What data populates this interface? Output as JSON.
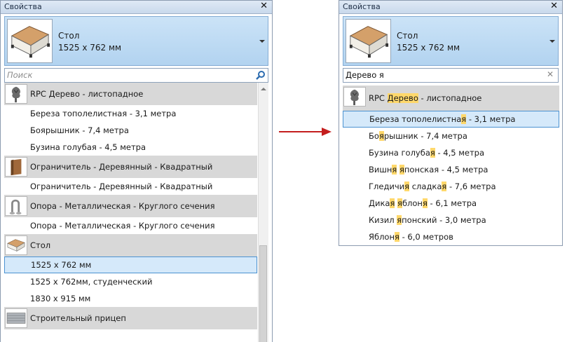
{
  "left": {
    "title": "Свойства",
    "close_label": "✕",
    "type_selector": {
      "name": "Стол",
      "size": "1525 x 762 мм"
    },
    "search": {
      "placeholder": "Поиск",
      "value": ""
    },
    "rows": [
      {
        "kind": "family",
        "icon": "tree-icon",
        "label": "RPC Дерево - листопадное"
      },
      {
        "kind": "type",
        "label": "Береза тополелистная - 3,1 метра"
      },
      {
        "kind": "type",
        "label": "Боярышник - 7,4 метра"
      },
      {
        "kind": "type",
        "label": "Бузина голубая - 4,5 метра"
      },
      {
        "kind": "family",
        "icon": "wood-block-icon",
        "label": "Ограничитель - Деревянный - Квадратный"
      },
      {
        "kind": "type",
        "label": "Ограничитель - Деревянный - Квадратный"
      },
      {
        "kind": "family",
        "icon": "post-icon",
        "label": "Опора - Металлическая - Круглого сечения"
      },
      {
        "kind": "type",
        "label": "Опора - Металлическая - Круглого сечения"
      },
      {
        "kind": "family",
        "icon": "table-icon",
        "label": "Стол"
      },
      {
        "kind": "type",
        "selected": true,
        "label": "1525 x 762 мм"
      },
      {
        "kind": "type",
        "label": "1525 x 762мм, студенческий"
      },
      {
        "kind": "type",
        "label": "1830 x 915 мм"
      },
      {
        "kind": "family",
        "icon": "trailer-icon",
        "label": "Строительный прицеп"
      }
    ]
  },
  "right": {
    "title": "Свойства",
    "close_label": "✕",
    "type_selector": {
      "name": "Стол",
      "size": "1525 x 762 мм"
    },
    "search": {
      "value": "Дерево я",
      "clear_label": "✕"
    },
    "rows": [
      {
        "kind": "family",
        "icon": "tree-icon",
        "parts": [
          {
            "t": "RPC "
          },
          {
            "t": "Дерево",
            "hl": true
          },
          {
            "t": " - листопадное"
          }
        ]
      },
      {
        "kind": "type",
        "selected": true,
        "parts": [
          {
            "t": "Береза тополелистна"
          },
          {
            "t": "я",
            "hl": true
          },
          {
            "t": " - 3,1 метра"
          }
        ]
      },
      {
        "kind": "type",
        "parts": [
          {
            "t": "Бо"
          },
          {
            "t": "я",
            "hl": true
          },
          {
            "t": "рышник - 7,4 метра"
          }
        ]
      },
      {
        "kind": "type",
        "parts": [
          {
            "t": "Бузина голуба"
          },
          {
            "t": "я",
            "hl": true
          },
          {
            "t": " - 4,5 метра"
          }
        ]
      },
      {
        "kind": "type",
        "parts": [
          {
            "t": "Вишн"
          },
          {
            "t": "я",
            "hl": true
          },
          {
            "t": " "
          },
          {
            "t": "я",
            "hl": true
          },
          {
            "t": "понская - 4,5 метра"
          }
        ]
      },
      {
        "kind": "type",
        "parts": [
          {
            "t": "Гледичи"
          },
          {
            "t": "я",
            "hl": true
          },
          {
            "t": " сладка"
          },
          {
            "t": "я",
            "hl": true
          },
          {
            "t": " - 7,6 метра"
          }
        ]
      },
      {
        "kind": "type",
        "parts": [
          {
            "t": "Дика"
          },
          {
            "t": "я",
            "hl": true
          },
          {
            "t": " "
          },
          {
            "t": "я",
            "hl": true
          },
          {
            "t": "блон"
          },
          {
            "t": "я",
            "hl": true
          },
          {
            "t": " - 6,1 метра"
          }
        ]
      },
      {
        "kind": "type",
        "parts": [
          {
            "t": "Кизил "
          },
          {
            "t": "я",
            "hl": true
          },
          {
            "t": "понский - 3,0 метра"
          }
        ]
      },
      {
        "kind": "type",
        "parts": [
          {
            "t": "Яблон"
          },
          {
            "t": "я",
            "hl": true
          },
          {
            "t": " - 6,0 метров"
          }
        ]
      }
    ]
  },
  "colors": {
    "selection": "#d5e9fa",
    "selection_border": "#4b92d1",
    "family_row": "#d8d8d8",
    "highlight": "#ffd86b",
    "arrow": "#c41e1e"
  }
}
